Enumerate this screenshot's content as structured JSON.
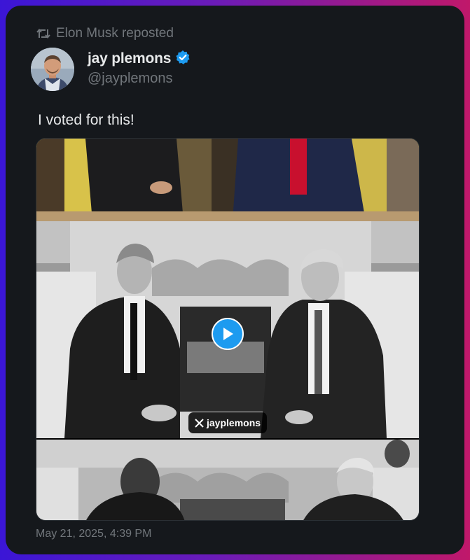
{
  "repost": {
    "icon": "repost-icon",
    "text": "Elon Musk reposted"
  },
  "author": {
    "display_name": "jay plemons",
    "handle": "@jayplemons",
    "verified_icon": "verified-badge-icon",
    "verified_color": "#1d9bf0"
  },
  "tweet": {
    "text": "I voted for this!",
    "timestamp": "May 21, 2025, 4:39 PM"
  },
  "media": {
    "type": "video",
    "play_icon": "play-icon",
    "watermark_icon": "x-logo-icon",
    "watermark_text": "jayplemons"
  },
  "colors": {
    "card_background": "#15181c",
    "primary_text": "#e7e9ea",
    "secondary_text": "#71767b",
    "accent": "#1d9bf0"
  }
}
